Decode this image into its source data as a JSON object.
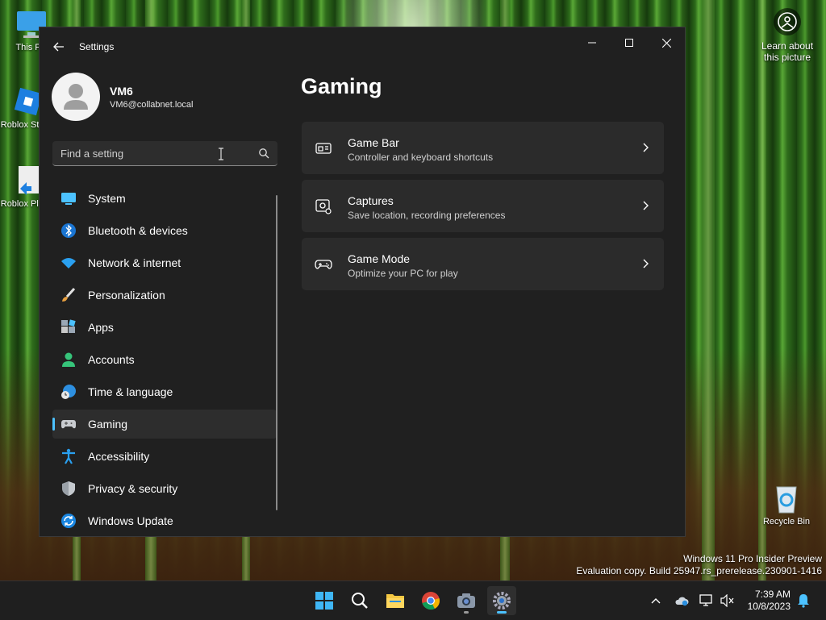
{
  "desktop": {
    "icons": [
      {
        "label": "This PC"
      },
      {
        "label": "Roblox Studio"
      },
      {
        "label": "Roblox Player"
      },
      {
        "label": "Recycle Bin"
      }
    ],
    "learn_about": "Learn about this picture",
    "watermark": {
      "line1": "Windows 11 Pro Insider Preview",
      "line2": "Evaluation copy. Build 25947.rs_prerelease.230901-1416"
    }
  },
  "window": {
    "title": "Settings",
    "profile": {
      "name": "VM6",
      "email": "VM6@collabnet.local"
    },
    "search": {
      "placeholder": "Find a setting"
    },
    "nav": [
      {
        "label": "System",
        "icon": "monitor-icon"
      },
      {
        "label": "Bluetooth & devices",
        "icon": "bluetooth-icon"
      },
      {
        "label": "Network & internet",
        "icon": "wifi-icon"
      },
      {
        "label": "Personalization",
        "icon": "brush-icon"
      },
      {
        "label": "Apps",
        "icon": "apps-icon"
      },
      {
        "label": "Accounts",
        "icon": "person-icon"
      },
      {
        "label": "Time & language",
        "icon": "clock-globe-icon"
      },
      {
        "label": "Gaming",
        "icon": "gamepad-icon",
        "active": true
      },
      {
        "label": "Accessibility",
        "icon": "accessibility-icon"
      },
      {
        "label": "Privacy & security",
        "icon": "shield-icon"
      },
      {
        "label": "Windows Update",
        "icon": "update-icon"
      }
    ],
    "page_title": "Gaming",
    "cards": [
      {
        "title": "Game Bar",
        "subtitle": "Controller and keyboard shortcuts",
        "icon": "game-bar-icon"
      },
      {
        "title": "Captures",
        "subtitle": "Save location, recording preferences",
        "icon": "capture-icon"
      },
      {
        "title": "Game Mode",
        "subtitle": "Optimize your PC for play",
        "icon": "game-mode-icon"
      }
    ]
  },
  "taskbar": {
    "time": "7:39 AM",
    "date": "10/8/2023"
  },
  "colors": {
    "accent": "#4cc2ff",
    "window_bg": "#202020",
    "card_bg": "#2b2b2b"
  }
}
